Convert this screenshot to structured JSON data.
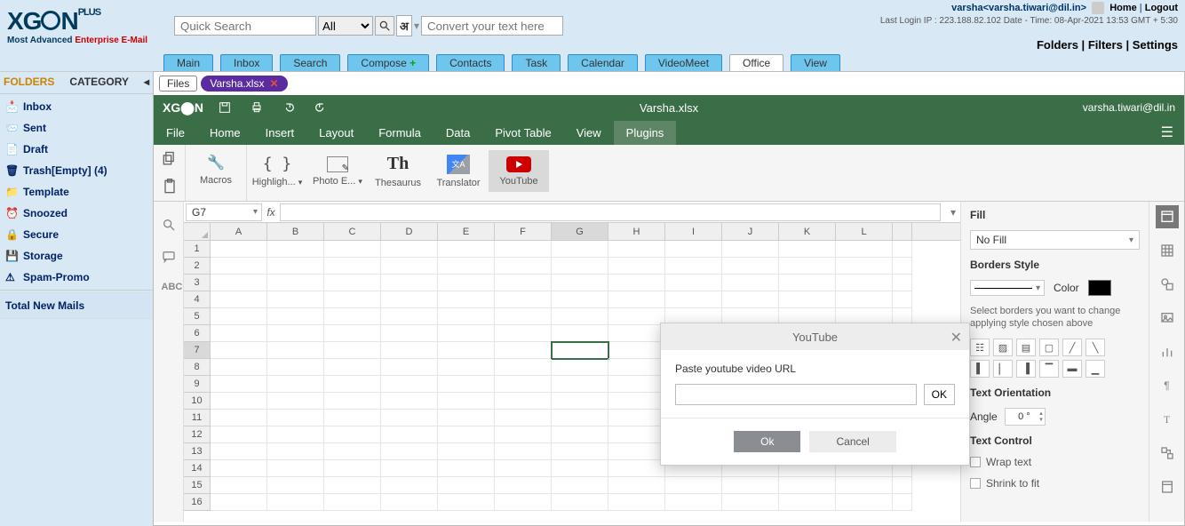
{
  "top": {
    "logo_text": "XG⬤N",
    "logo_sub1": "Most Advanced ",
    "logo_sub2": "Enterprise E-Mail",
    "quick_search_placeholder": "Quick Search",
    "all_option": "All",
    "devnag": "अ",
    "convert_placeholder": "Convert your text here",
    "welcome_user": "varsha<varsha.tiwari@dil.in>",
    "home": "Home",
    "logout": "Logout",
    "last_login": "Last Login IP : 223.188.82.102 Date - Time: 08-Apr-2021 13:53 GMT + 5:30",
    "links": {
      "folders": "Folders",
      "filters": "Filters",
      "settings": "Settings"
    }
  },
  "apptabs": [
    "Main",
    "Inbox",
    "Search",
    "Compose",
    "Contacts",
    "Task",
    "Calendar",
    "VideoMeet",
    "Office",
    "View"
  ],
  "apptab_active": "Office",
  "sidebar": {
    "folders": "FOLDERS",
    "category": "CATEGORY",
    "items": [
      {
        "icon": "inbox",
        "label": "Inbox"
      },
      {
        "icon": "sent",
        "label": "Sent"
      },
      {
        "icon": "draft",
        "label": "Draft"
      },
      {
        "icon": "trash",
        "label": "Trash[Empty] (4)"
      },
      {
        "icon": "template",
        "label": "Template"
      },
      {
        "icon": "snoozed",
        "label": "Snoozed"
      },
      {
        "icon": "secure",
        "label": "Secure"
      },
      {
        "icon": "storage",
        "label": "Storage"
      },
      {
        "icon": "spam",
        "label": "Spam-Promo"
      }
    ],
    "total": "Total New Mails"
  },
  "filebar": {
    "files": "Files",
    "filename": "Varsha.xlsx"
  },
  "sheet": {
    "titlebar_file": "Varsha.xlsx",
    "user_email": "varsha.tiwari@dil.in",
    "brand": "XG⬤N",
    "menus": [
      "File",
      "Home",
      "Insert",
      "Layout",
      "Formula",
      "Data",
      "Pivot Table",
      "View",
      "Plugins"
    ],
    "menu_active": "Plugins",
    "ribbon": [
      {
        "id": "macros",
        "label": "Macros"
      },
      {
        "id": "highlight",
        "label": "Highligh..."
      },
      {
        "id": "photoeditor",
        "label": "Photo E..."
      },
      {
        "id": "thesaurus",
        "label": "Thesaurus"
      },
      {
        "id": "translator",
        "label": "Translator"
      },
      {
        "id": "youtube",
        "label": "YouTube"
      }
    ],
    "cellref": "G7",
    "columns": [
      "A",
      "B",
      "C",
      "D",
      "E",
      "F",
      "G",
      "H",
      "I",
      "J",
      "K",
      "L"
    ],
    "rows_count": 16,
    "sel_col": "G",
    "sel_row": 7
  },
  "rightpanel": {
    "fill": "Fill",
    "nofill": "No Fill",
    "borders_style": "Borders Style",
    "color": "Color",
    "hint": "Select borders you want to change applying style chosen above",
    "text_orientation": "Text Orientation",
    "angle": "Angle",
    "angle_val": "0 °",
    "text_control": "Text Control",
    "wrap": "Wrap text",
    "shrink": "Shrink to fit"
  },
  "modal": {
    "title": "YouTube",
    "label": "Paste youtube video URL",
    "ok_small": "OK",
    "ok": "Ok",
    "cancel": "Cancel"
  }
}
